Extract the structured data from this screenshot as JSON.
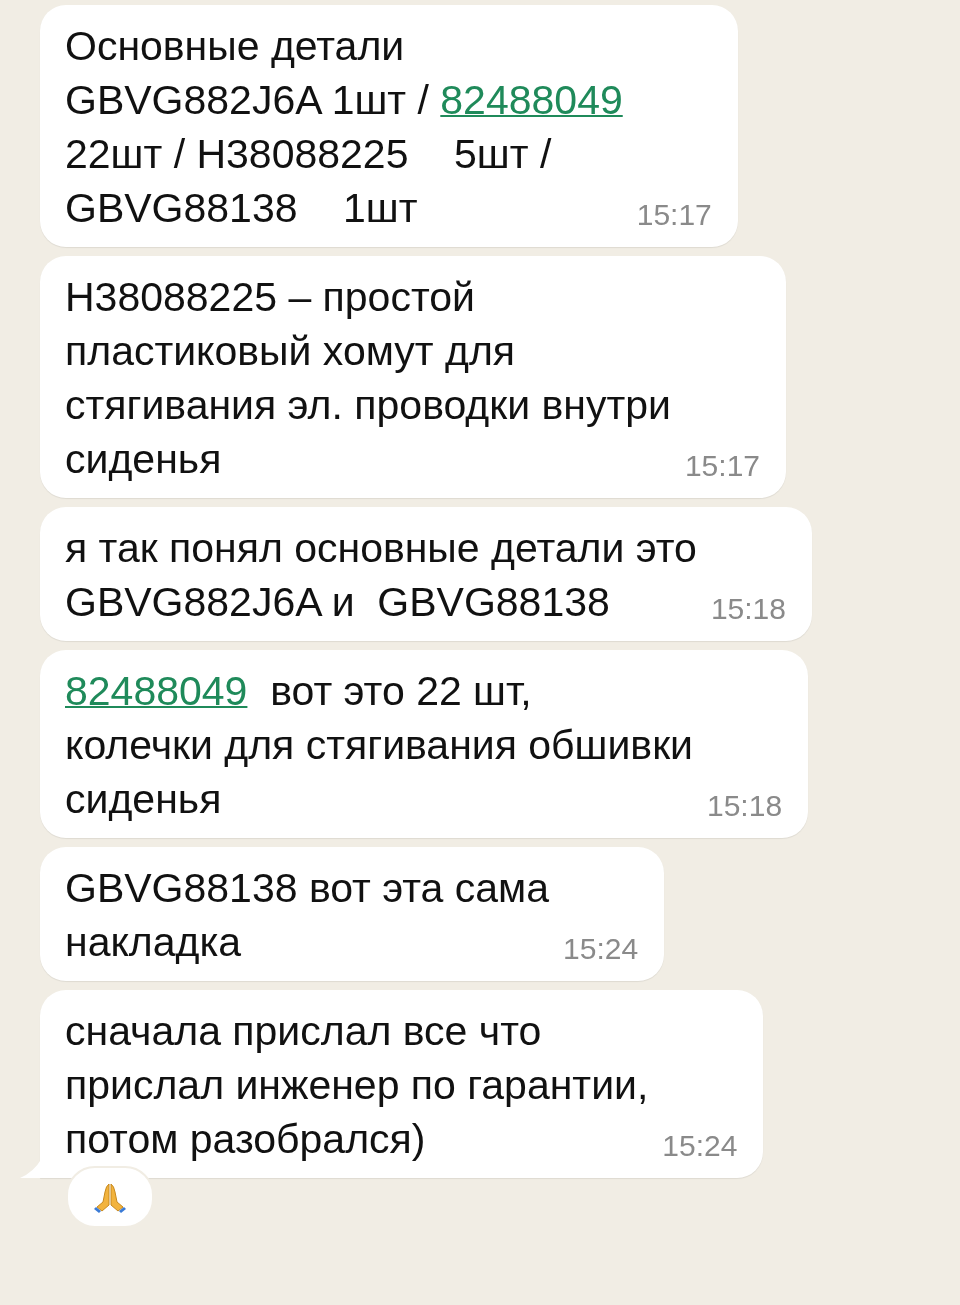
{
  "messages": [
    {
      "lines": [
        [
          {
            "text": "Основные детали",
            "link": false
          }
        ],
        [
          {
            "text": "GBVG882J6A 1шт / ",
            "link": false
          },
          {
            "text": "82488049",
            "link": true
          }
        ],
        [
          {
            "text": "22шт / H38088225    5шт /",
            "link": false
          }
        ],
        [
          {
            "text": "GBVG88138    1шт",
            "link": false
          }
        ]
      ],
      "time": "15:17",
      "tail": false,
      "reaction": false
    },
    {
      "lines": [
        [
          {
            "text": "H38088225 – простой",
            "link": false
          }
        ],
        [
          {
            "text": "пластиковый хомут для",
            "link": false
          }
        ],
        [
          {
            "text": "стягивания эл. проводки внутри",
            "link": false
          }
        ],
        [
          {
            "text": "сиденья",
            "link": false
          }
        ]
      ],
      "time": "15:17",
      "tail": false,
      "reaction": false
    },
    {
      "lines": [
        [
          {
            "text": "я так понял основные детали это",
            "link": false
          }
        ],
        [
          {
            "text": "GBVG882J6A и  GBVG88138",
            "link": false
          }
        ]
      ],
      "time": "15:18",
      "tail": false,
      "reaction": false
    },
    {
      "lines": [
        [
          {
            "text": "82488049",
            "link": true
          },
          {
            "text": "  вот это 22 шт,",
            "link": false
          }
        ],
        [
          {
            "text": "колечки для стягивания обшивки",
            "link": false
          }
        ],
        [
          {
            "text": "сиденья",
            "link": false
          }
        ]
      ],
      "time": "15:18",
      "tail": false,
      "reaction": false
    },
    {
      "lines": [
        [
          {
            "text": "GBVG88138 вот эта сама",
            "link": false
          }
        ],
        [
          {
            "text": "накладка",
            "link": false
          }
        ]
      ],
      "time": "15:24",
      "tail": false,
      "reaction": false
    },
    {
      "lines": [
        [
          {
            "text": "сначала прислал все что",
            "link": false
          }
        ],
        [
          {
            "text": "прислал инженер по гарантии,",
            "link": false
          }
        ],
        [
          {
            "text": "потом разобрался)",
            "link": false
          }
        ]
      ],
      "time": "15:24",
      "tail": true,
      "reaction": true
    }
  ]
}
